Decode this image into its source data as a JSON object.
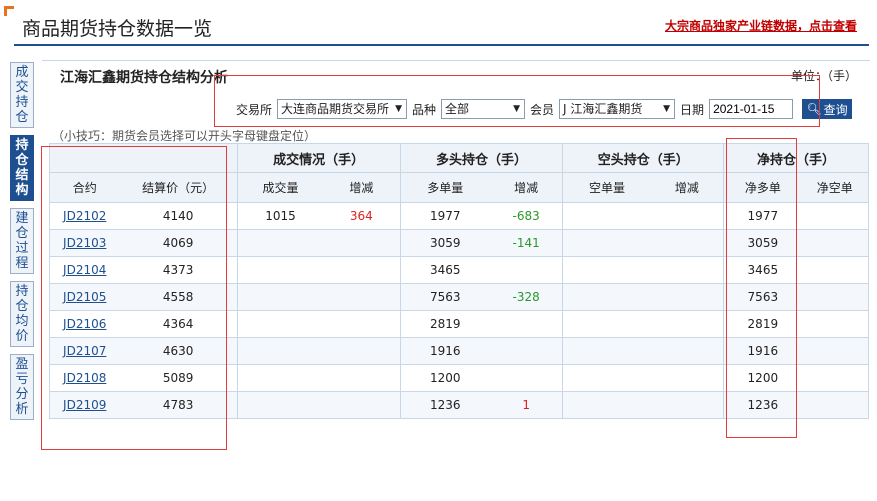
{
  "header": {
    "title": "商品期货持仓数据一览",
    "promo_link": "大宗商品独家产业链数据，点击查看"
  },
  "side_tabs": [
    "成交持仓",
    "持仓结构",
    "建仓过程",
    "持仓均价",
    "盈亏分析"
  ],
  "section": {
    "title": "江海汇鑫期货持仓结构分析",
    "unit": "单位：（手）"
  },
  "filters": {
    "exchange_label": "交易所",
    "exchange_value": "大连商品期货交易所",
    "variety_label": "品种",
    "variety_value": "全部",
    "member_label": "会员",
    "member_value": "J 江海汇鑫期货",
    "date_label": "日期",
    "date_value": "2021-01-15",
    "query_label": "查询"
  },
  "tip": "（小技巧：期货会员选择可以开头字母键盘定位）",
  "table": {
    "group_headers": [
      "成交情况（手）",
      "多头持仓（手）",
      "空头持仓（手）",
      "净持仓（手）"
    ],
    "sub_headers": [
      "合约",
      "结算价（元）",
      "成交量",
      "增减",
      "多单量",
      "增减",
      "空单量",
      "增减",
      "净多单",
      "净空单"
    ],
    "rows": [
      {
        "contract": "JD2102",
        "price": "4140",
        "volume": "1015",
        "volume_change": "364",
        "long": "1977",
        "long_change": "-683",
        "short": "",
        "short_change": "",
        "net_long": "1977",
        "net_short": ""
      },
      {
        "contract": "JD2103",
        "price": "4069",
        "volume": "",
        "volume_change": "",
        "long": "3059",
        "long_change": "-141",
        "short": "",
        "short_change": "",
        "net_long": "3059",
        "net_short": ""
      },
      {
        "contract": "JD2104",
        "price": "4373",
        "volume": "",
        "volume_change": "",
        "long": "3465",
        "long_change": "",
        "short": "",
        "short_change": "",
        "net_long": "3465",
        "net_short": ""
      },
      {
        "contract": "JD2105",
        "price": "4558",
        "volume": "",
        "volume_change": "",
        "long": "7563",
        "long_change": "-328",
        "short": "",
        "short_change": "",
        "net_long": "7563",
        "net_short": ""
      },
      {
        "contract": "JD2106",
        "price": "4364",
        "volume": "",
        "volume_change": "",
        "long": "2819",
        "long_change": "",
        "short": "",
        "short_change": "",
        "net_long": "2819",
        "net_short": ""
      },
      {
        "contract": "JD2107",
        "price": "4630",
        "volume": "",
        "volume_change": "",
        "long": "1916",
        "long_change": "",
        "short": "",
        "short_change": "",
        "net_long": "1916",
        "net_short": ""
      },
      {
        "contract": "JD2108",
        "price": "5089",
        "volume": "",
        "volume_change": "",
        "long": "1200",
        "long_change": "",
        "short": "",
        "short_change": "",
        "net_long": "1200",
        "net_short": ""
      },
      {
        "contract": "JD2109",
        "price": "4783",
        "volume": "",
        "volume_change": "",
        "long": "1236",
        "long_change": "1",
        "short": "",
        "short_change": "",
        "net_long": "1236",
        "net_short": ""
      }
    ]
  },
  "colors": {
    "brand_blue": "#1e4f91",
    "increase_red": "#e02020",
    "decrease_green": "#2a9a2a",
    "annotation_red": "#e33b3b",
    "accent_orange": "#e8731c"
  }
}
